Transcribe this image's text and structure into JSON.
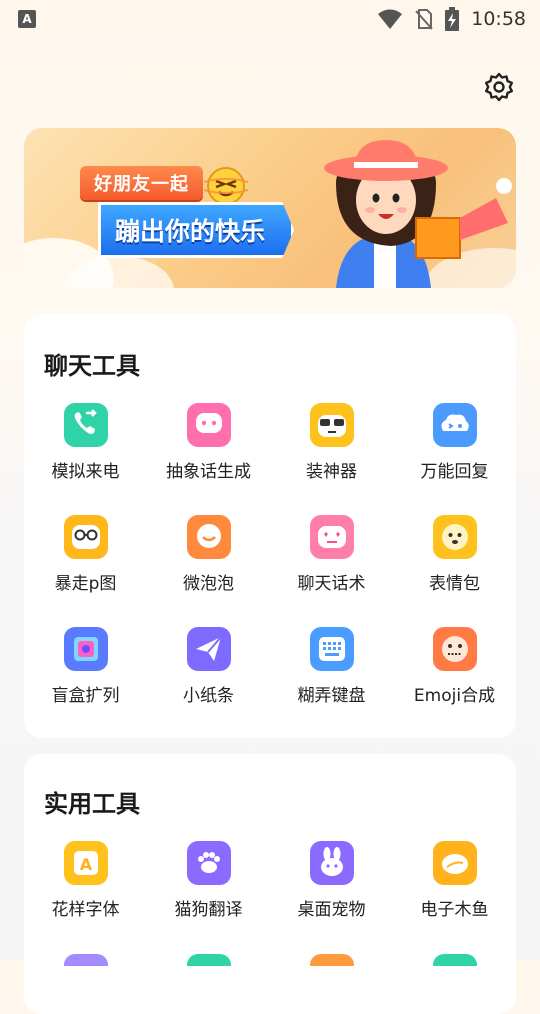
{
  "status_bar": {
    "notification_letter": "A",
    "time": "10:58"
  },
  "banner": {
    "tag": "好朋友一起",
    "title": "蹦出你的快乐"
  },
  "sections": [
    {
      "title": "聊天工具",
      "tools": [
        {
          "label": "模拟来电",
          "icon": "phone-call-icon",
          "color": "#2fd3a7"
        },
        {
          "label": "抽象话生成",
          "icon": "chat-bubble-face-icon",
          "color": "#ff6fae"
        },
        {
          "label": "装神器",
          "icon": "sunglasses-icon",
          "color": "#ffc21d"
        },
        {
          "label": "万能回复",
          "icon": "cloud-face-icon",
          "color": "#4b9bff"
        },
        {
          "label": "暴走p图",
          "icon": "glasses-face-icon",
          "color": "#ffb81c"
        },
        {
          "label": "微泡泡",
          "icon": "smile-bubble-icon",
          "color": "#ff8a3d"
        },
        {
          "label": "聊天话术",
          "icon": "heart-eyes-icon",
          "color": "#ff7fa8"
        },
        {
          "label": "表情包",
          "icon": "emoji-face-icon",
          "color": "#ffc21d"
        },
        {
          "label": "盲盒扩列",
          "icon": "blind-box-icon",
          "color": "#5a7bff"
        },
        {
          "label": "小纸条",
          "icon": "paper-plane-icon",
          "color": "#7d6bff"
        },
        {
          "label": "糊弄键盘",
          "icon": "keyboard-icon",
          "color": "#4a9dff"
        },
        {
          "label": "Emoji合成",
          "icon": "emoji-mix-icon",
          "color": "#ff7a45"
        }
      ]
    },
    {
      "title": "实用工具",
      "tools": [
        {
          "label": "花样字体",
          "icon": "font-style-icon",
          "color": "#ffc21d"
        },
        {
          "label": "猫狗翻译",
          "icon": "paw-icon",
          "color": "#8b6bff"
        },
        {
          "label": "桌面宠物",
          "icon": "bunny-icon",
          "color": "#8b6bff"
        },
        {
          "label": "电子木鱼",
          "icon": "wooden-fish-icon",
          "color": "#ffb21c"
        }
      ]
    }
  ]
}
